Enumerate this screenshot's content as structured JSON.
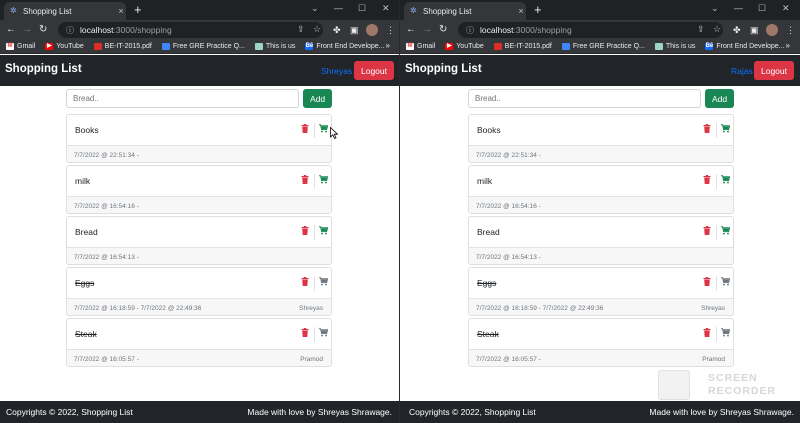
{
  "colors": {
    "chrome_dark": "#202124",
    "chrome_toolbar": "#35363a",
    "navbar": "#212529",
    "success": "#198754",
    "danger": "#dc3545",
    "primary": "#0d6efd"
  },
  "browser": {
    "tab_title": "Shopping List",
    "tab_close": "×",
    "new_tab": "+",
    "url_host": "localhost",
    "url_path": ":3000/shopping",
    "bookmarks": [
      {
        "label": "Gmail",
        "icon": "gmail-icon"
      },
      {
        "label": "YouTube",
        "icon": "youtube-icon"
      },
      {
        "label": "BE-IT-2015.pdf",
        "icon": "pdf-icon"
      },
      {
        "label": "Free GRE Practice Q...",
        "icon": "doc-icon"
      },
      {
        "label": "This is us",
        "icon": "page-icon"
      },
      {
        "label": "Front End Develope...",
        "icon": "behance-icon"
      }
    ],
    "bookmarks_more": "»"
  },
  "app": {
    "brand": "Shopping List",
    "logout_label": "Logout",
    "add_label": "Add",
    "input_placeholder": "Bread..",
    "footer_left": "Copyrights © 2022, Shopping List",
    "footer_right": "Made with love by Shreyas Shrawage."
  },
  "left": {
    "username": "Shreyas",
    "items": [
      {
        "name": "Books",
        "time": "7/7/2022 @ 22:51:34 -",
        "by": "",
        "done": false
      },
      {
        "name": "milk",
        "time": "7/7/2022 @ 16:54:16 -",
        "by": "",
        "done": false
      },
      {
        "name": "Bread",
        "time": "7/7/2022 @ 16:54:13 -",
        "by": "",
        "done": false
      },
      {
        "name": "Eggs",
        "time": "7/7/2022 @ 16:18:59 - 7/7/2022 @ 22:49:36",
        "by": "Shreyas",
        "done": true
      },
      {
        "name": "Steak",
        "time": "7/7/2022 @ 16:05:57 -",
        "by": "Pramod",
        "done": true
      }
    ]
  },
  "right": {
    "username": "Rajas",
    "items": [
      {
        "name": "Books",
        "time": "7/7/2022 @ 22:51:34 -",
        "by": "",
        "done": false
      },
      {
        "name": "milk",
        "time": "7/7/2022 @ 16:54:16 -",
        "by": "",
        "done": false
      },
      {
        "name": "Bread",
        "time": "7/7/2022 @ 16:54:13 -",
        "by": "",
        "done": false
      },
      {
        "name": "Eggs",
        "time": "7/7/2022 @ 16:18:59 - 7/7/2022 @ 22:49:36",
        "by": "Shreyas",
        "done": true
      },
      {
        "name": "Steak",
        "time": "7/7/2022 @ 16:05:57 -",
        "by": "Pramod",
        "done": true
      }
    ]
  },
  "watermark": {
    "text": "SCREEN\nRECORDER"
  }
}
